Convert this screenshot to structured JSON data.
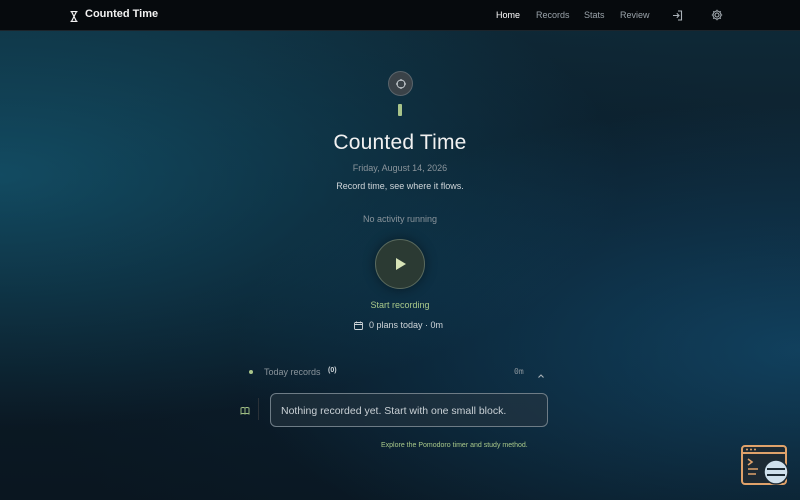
{
  "app": {
    "title": "Counted Time",
    "brand_icon": "hourglass-icon"
  },
  "nav": {
    "links": [
      {
        "label": "Home",
        "active": true
      },
      {
        "label": "Records",
        "active": false
      },
      {
        "label": "Stats",
        "active": false
      },
      {
        "label": "Review",
        "active": false
      }
    ],
    "icons": [
      "sign-in-icon",
      "gear-icon"
    ]
  },
  "hero": {
    "title": "Counted Time",
    "date": "Friday, August 14, 2026",
    "tagline": "Record time, see where it flows."
  },
  "timer": {
    "status": "No activity running",
    "start_label": "Start recording",
    "plans_summary": "0 plans today · 0m"
  },
  "today": {
    "label": "Today records",
    "count": "(0)",
    "total": "0m",
    "empty_message": "Nothing recorded yet. Start with one small block."
  },
  "footer": {
    "explore_link": "Explore the Pomodoro timer and study method."
  },
  "colors": {
    "accent": "#a9c98a",
    "background": "#0c1d2a",
    "topbar": "#060a0d"
  }
}
